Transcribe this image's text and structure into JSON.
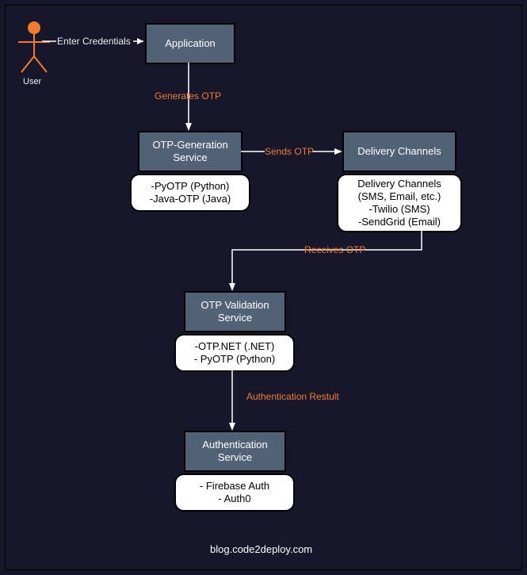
{
  "actor": {
    "label": "User"
  },
  "nodes": {
    "application": {
      "title": "Application"
    },
    "otp_gen": {
      "title1": "OTP-Generation",
      "title2": "Service"
    },
    "delivery": {
      "title": "Delivery Channels"
    },
    "otp_val": {
      "title1": "OTP Validation",
      "title2": "Service"
    },
    "auth": {
      "title1": "Authentication",
      "title2": "Service"
    }
  },
  "details": {
    "otp_gen": {
      "l1": "-PyOTP (Python)",
      "l2": "-Java-OTP (Java)"
    },
    "delivery": {
      "l1": "Delivery Channels",
      "l2": "(SMS, Email, etc.)",
      "l3": "-Twilio (SMS)",
      "l4": "-SendGrid (Email)"
    },
    "otp_val": {
      "l1": "-OTP.NET (.NET)",
      "l2": "- PyOTP (Python)"
    },
    "auth": {
      "l1": "- Firebase Auth",
      "l2": "- Auth0"
    }
  },
  "edges": {
    "enter_credentials": "Enter Credentials",
    "generates_otp": "Generates OTP",
    "sends_otp": "Sends OTP",
    "receives_otp": "Receives OTP",
    "auth_result": "Authentication Restult"
  },
  "footer": "blog.code2deploy.com"
}
